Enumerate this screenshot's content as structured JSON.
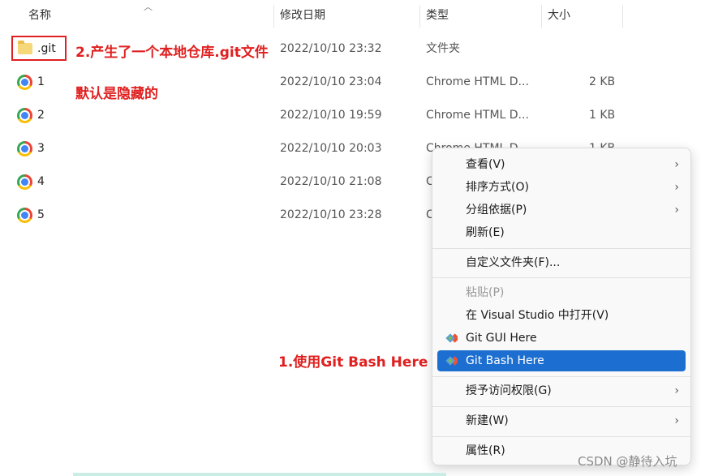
{
  "columns": {
    "name": "名称",
    "modified": "修改日期",
    "type": "类型",
    "size": "大小"
  },
  "files": [
    {
      "name": ".git",
      "modified": "2022/10/10 23:32",
      "type": "文件夹",
      "size": "",
      "icon": "folder-icon"
    },
    {
      "name": "1",
      "modified": "2022/10/10 23:04",
      "type": "Chrome HTML D...",
      "size": "2 KB",
      "icon": "chrome-icon"
    },
    {
      "name": "2",
      "modified": "2022/10/10 19:59",
      "type": "Chrome HTML D...",
      "size": "1 KB",
      "icon": "chrome-icon"
    },
    {
      "name": "3",
      "modified": "2022/10/10 20:03",
      "type": "Chrome HTML D...",
      "size": "1 KB",
      "icon": "chrome-icon"
    },
    {
      "name": "4",
      "modified": "2022/10/10 21:08",
      "type": "C",
      "size": "",
      "icon": "chrome-icon"
    },
    {
      "name": "5",
      "modified": "2022/10/10 23:28",
      "type": "C",
      "size": "",
      "icon": "chrome-icon"
    }
  ],
  "annotations": {
    "git_note": "2.产生了一个本地仓库.git文件",
    "hidden_note": "默认是隐藏的",
    "step1_note": "1.使用Git Bash Here"
  },
  "context_menu": {
    "view": "查看(V)",
    "sort": "排序方式(O)",
    "group": "分组依据(P)",
    "refresh": "刷新(E)",
    "customize": "自定义文件夹(F)...",
    "paste": "粘贴(P)",
    "open_vs": "在 Visual Studio 中打开(V)",
    "git_gui": "Git GUI Here",
    "git_bash": "Git Bash Here",
    "grant_access": "授予访问权限(G)",
    "new": "新建(W)",
    "properties": "属性(R)"
  },
  "watermark": "CSDN @静待入坑",
  "colors": {
    "annotation": "#e02020",
    "menu_selected": "#1c6fd1"
  }
}
